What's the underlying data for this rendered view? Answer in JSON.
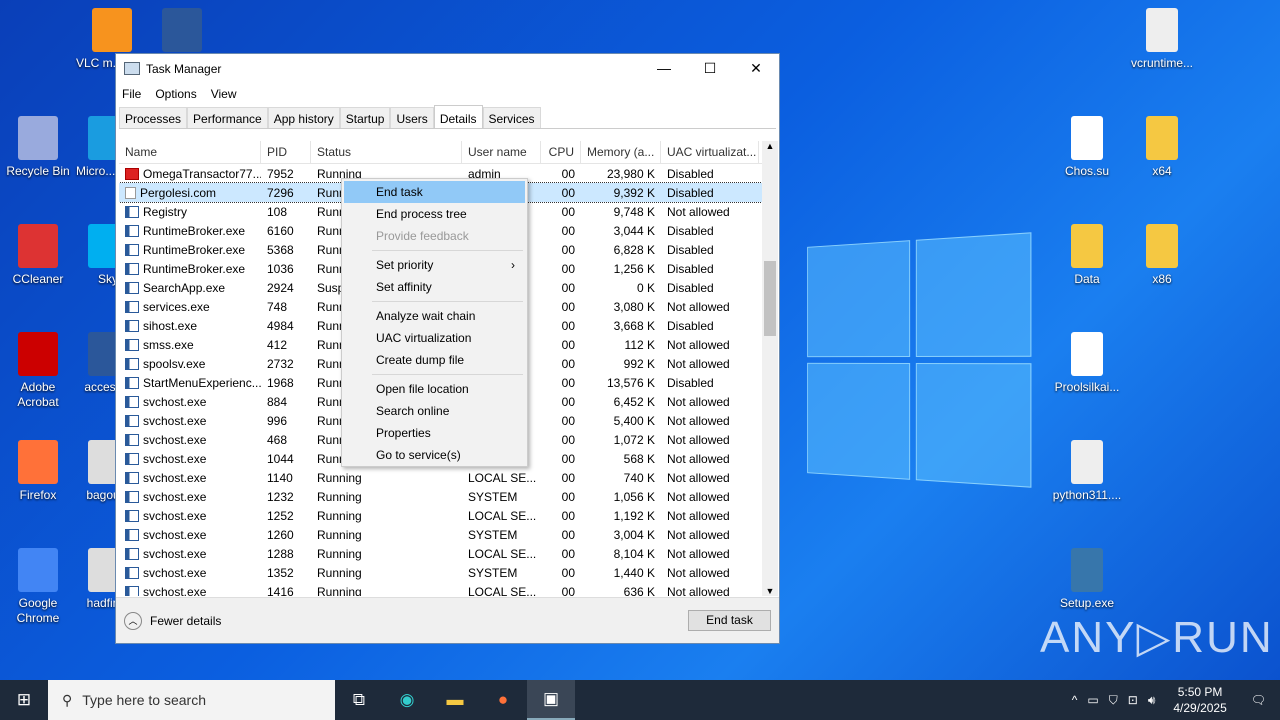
{
  "desktop": {
    "left": [
      {
        "label": "VLC m... play",
        "color": "#f7931e"
      },
      {
        "label": "",
        "color": "#2b579a"
      },
      {
        "label": "Recycle Bin",
        "color": "#9ad"
      },
      {
        "label": "Micro... Edg",
        "color": "#1a9ce0"
      },
      {
        "label": "CCleaner",
        "color": "#d33"
      },
      {
        "label": "Sky",
        "color": "#00aff0"
      },
      {
        "label": "Adobe Acrobat",
        "color": "#c00"
      },
      {
        "label": "access...",
        "color": "#2b579a"
      },
      {
        "label": "Firefox",
        "color": "#ff7139"
      },
      {
        "label": "bagou...",
        "color": "#ddd"
      },
      {
        "label": "Google Chrome",
        "color": "#4285f4"
      },
      {
        "label": "hadfin...",
        "color": "#ddd"
      }
    ],
    "right": [
      {
        "label": "vcruntime...",
        "color": "#eee"
      },
      {
        "label": "Chos.su",
        "color": "#fff"
      },
      {
        "label": "x64",
        "color": "#f5c842"
      },
      {
        "label": "Data",
        "color": "#f5c842"
      },
      {
        "label": "x86",
        "color": "#f5c842"
      },
      {
        "label": "Proolsilkai...",
        "color": "#fff"
      },
      {
        "label": "python311....",
        "color": "#eee"
      },
      {
        "label": "Setup.exe",
        "color": "#3776ab"
      }
    ]
  },
  "window": {
    "title": "Task Manager",
    "minimize": "—",
    "maximize": "☐",
    "close": "✕",
    "menu": [
      "File",
      "Options",
      "View"
    ],
    "tabs": [
      "Processes",
      "Performance",
      "App history",
      "Startup",
      "Users",
      "Details",
      "Services"
    ],
    "columns": [
      "Name",
      "PID",
      "Status",
      "User name",
      "CPU",
      "Memory (a...",
      "UAC virtualizat..."
    ],
    "rows": [
      [
        "OmegaTransactor77....",
        "7952",
        "Running",
        "admin",
        "00",
        "23,980 K",
        "Disabled"
      ],
      [
        "Pergolesi.com",
        "7296",
        "Running",
        "",
        "00",
        "9,392 K",
        "Disabled"
      ],
      [
        "Registry",
        "108",
        "Running",
        "",
        "00",
        "9,748 K",
        "Not allowed"
      ],
      [
        "RuntimeBroker.exe",
        "6160",
        "Running",
        "",
        "00",
        "3,044 K",
        "Disabled"
      ],
      [
        "RuntimeBroker.exe",
        "5368",
        "Running",
        "",
        "00",
        "6,828 K",
        "Disabled"
      ],
      [
        "RuntimeBroker.exe",
        "1036",
        "Running",
        "",
        "00",
        "1,256 K",
        "Disabled"
      ],
      [
        "SearchApp.exe",
        "2924",
        "Suspended",
        "",
        "00",
        "0 K",
        "Disabled"
      ],
      [
        "services.exe",
        "748",
        "Running",
        "",
        "00",
        "3,080 K",
        "Not allowed"
      ],
      [
        "sihost.exe",
        "4984",
        "Running",
        "",
        "00",
        "3,668 K",
        "Disabled"
      ],
      [
        "smss.exe",
        "412",
        "Running",
        "",
        "00",
        "112 K",
        "Not allowed"
      ],
      [
        "spoolsv.exe",
        "2732",
        "Running",
        "",
        "00",
        "992 K",
        "Not allowed"
      ],
      [
        "StartMenuExperienc...",
        "1968",
        "Running",
        "",
        "00",
        "13,576 K",
        "Disabled"
      ],
      [
        "svchost.exe",
        "884",
        "Running",
        "",
        "00",
        "6,452 K",
        "Not allowed"
      ],
      [
        "svchost.exe",
        "996",
        "Running",
        "",
        "00",
        "5,400 K",
        "Not allowed"
      ],
      [
        "svchost.exe",
        "468",
        "Running",
        "",
        "00",
        "1,072 K",
        "Not allowed"
      ],
      [
        "svchost.exe",
        "1044",
        "Running",
        "",
        "00",
        "568 K",
        "Not allowed"
      ],
      [
        "svchost.exe",
        "1140",
        "Running",
        "LOCAL SE...",
        "00",
        "740 K",
        "Not allowed"
      ],
      [
        "svchost.exe",
        "1232",
        "Running",
        "SYSTEM",
        "00",
        "1,056 K",
        "Not allowed"
      ],
      [
        "svchost.exe",
        "1252",
        "Running",
        "LOCAL SE...",
        "00",
        "1,192 K",
        "Not allowed"
      ],
      [
        "svchost.exe",
        "1260",
        "Running",
        "SYSTEM",
        "00",
        "3,004 K",
        "Not allowed"
      ],
      [
        "svchost.exe",
        "1288",
        "Running",
        "LOCAL SE...",
        "00",
        "8,104 K",
        "Not allowed"
      ],
      [
        "svchost.exe",
        "1352",
        "Running",
        "SYSTEM",
        "00",
        "1,440 K",
        "Not allowed"
      ],
      [
        "svchost.exe",
        "1416",
        "Running",
        "LOCAL SE...",
        "00",
        "636 K",
        "Not allowed"
      ]
    ],
    "fewer_details": "Fewer details",
    "end_task": "End task"
  },
  "context_menu": [
    "End task",
    "End process tree",
    "Provide feedback",
    "-",
    "Set priority",
    "Set affinity",
    "-",
    "Analyze wait chain",
    "UAC virtualization",
    "Create dump file",
    "-",
    "Open file location",
    "Search online",
    "Properties",
    "Go to service(s)"
  ],
  "taskbar": {
    "search_placeholder": "Type here to search",
    "time": "5:50 PM",
    "date": "4/29/2025"
  },
  "watermark": "ANY▷RUN"
}
